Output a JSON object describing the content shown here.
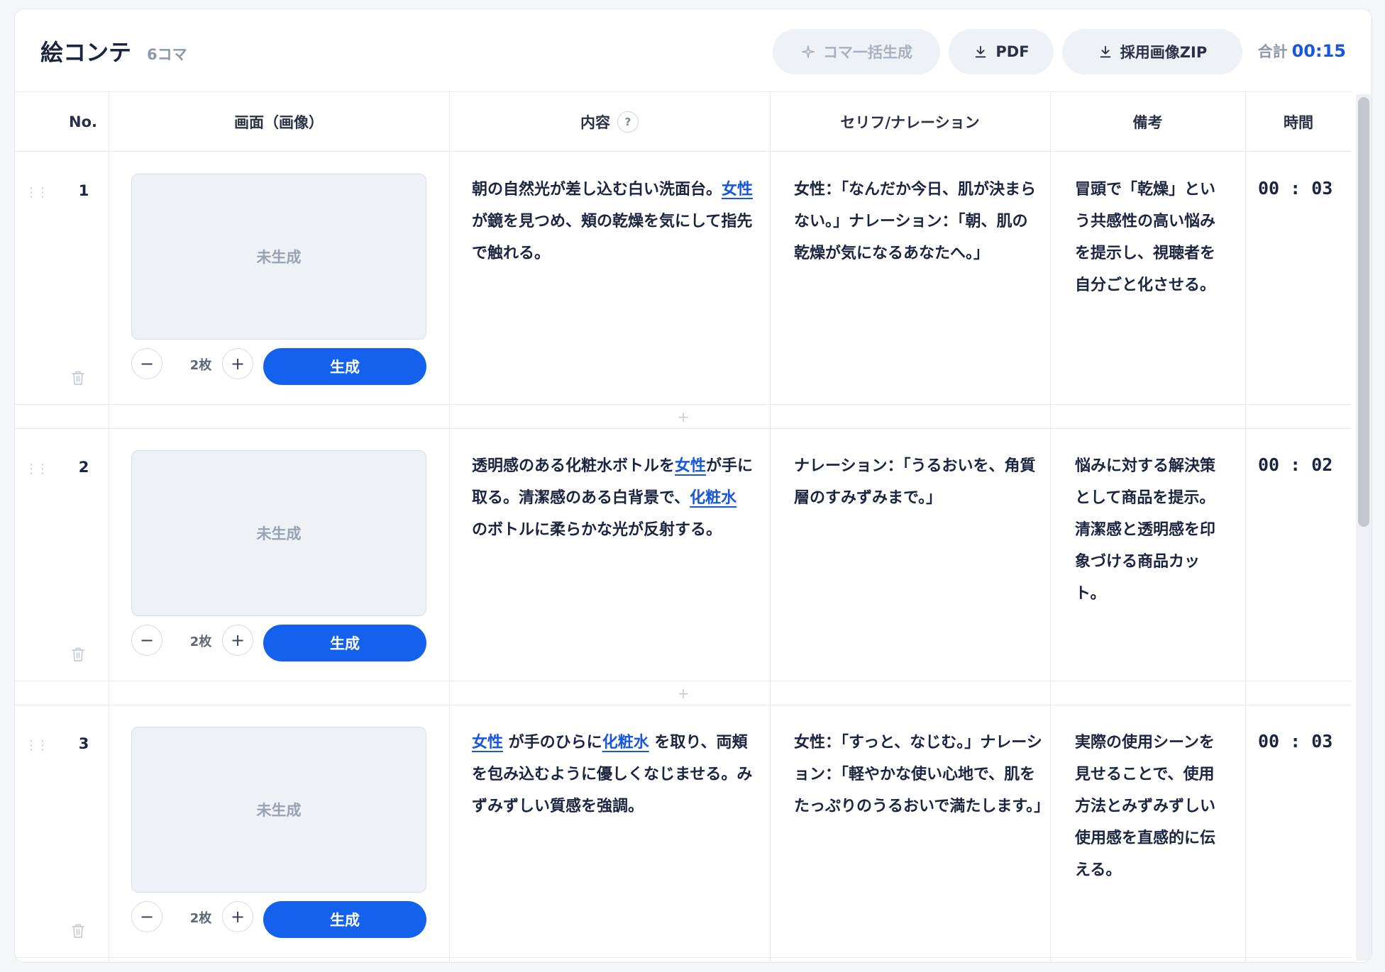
{
  "header": {
    "title": "絵コンテ",
    "count": "6コマ",
    "bulk_generate_label": "コマ一括生成",
    "pdf_label": "PDF",
    "zip_label": "採用画像ZIP",
    "total_label": "合計",
    "total_time": "00:15"
  },
  "columns": {
    "no": "No.",
    "image": "画面（画像）",
    "content": "内容",
    "help": "?",
    "serif": "セリフ/ナレーション",
    "note": "備考",
    "time": "時間"
  },
  "separator_plus": "+",
  "rows": [
    {
      "no": "1",
      "image_status": "未生成",
      "minus": "−",
      "plus": "+",
      "count": "2枚",
      "generate_label": "生成",
      "content": [
        {
          "t": "朝の自然光が差し込む白い洗面台。"
        },
        {
          "t": "女性",
          "hl": true
        },
        {
          "t": " が鏡を見つめ、頬の乾燥を気にして指先で触れる。"
        }
      ],
      "serif": "女性：「なんだか今日、肌が決まらない。」ナレーション：「朝、肌の乾燥が気になるあなたへ。」",
      "note": "冒頭で「乾燥」という共感性の高い悩みを提示し、視聴者を自分ごと化させる。",
      "time": "00 : 03"
    },
    {
      "no": "2",
      "image_status": "未生成",
      "minus": "−",
      "plus": "+",
      "count": "2枚",
      "generate_label": "生成",
      "content": [
        {
          "t": "透明感のある化粧水ボトルを"
        },
        {
          "t": "女性",
          "hl": true
        },
        {
          "t": "が手に取る。清潔感のある白背景で、"
        },
        {
          "t": "化粧水",
          "hl": true
        },
        {
          "t": " のボトルに柔らかな光が反射する。"
        }
      ],
      "serif": "ナレーション：「うるおいを、角質層のすみずみまで。」",
      "note": "悩みに対する解決策として商品を提示。清潔感と透明感を印象づける商品カット。",
      "time": "00 : 02"
    },
    {
      "no": "3",
      "image_status": "未生成",
      "minus": "−",
      "plus": "+",
      "count": "2枚",
      "generate_label": "生成",
      "content": [
        {
          "t": "女性",
          "hl": true
        },
        {
          "t": " が手のひらに"
        },
        {
          "t": "化粧水",
          "hl": true
        },
        {
          "t": " を取り、両頬を包み込むように優しくなじませる。みずみずしい質感を強調。"
        }
      ],
      "serif": "女性：「すっと、なじむ。」ナレーション：「軽やかな使い心地で、肌をたっぷりのうるおいで満たします。」",
      "note": "実際の使用シーンを見せることで、使用方法とみずみずしい使用感を直感的に伝える。",
      "time": "00 : 03"
    }
  ]
}
